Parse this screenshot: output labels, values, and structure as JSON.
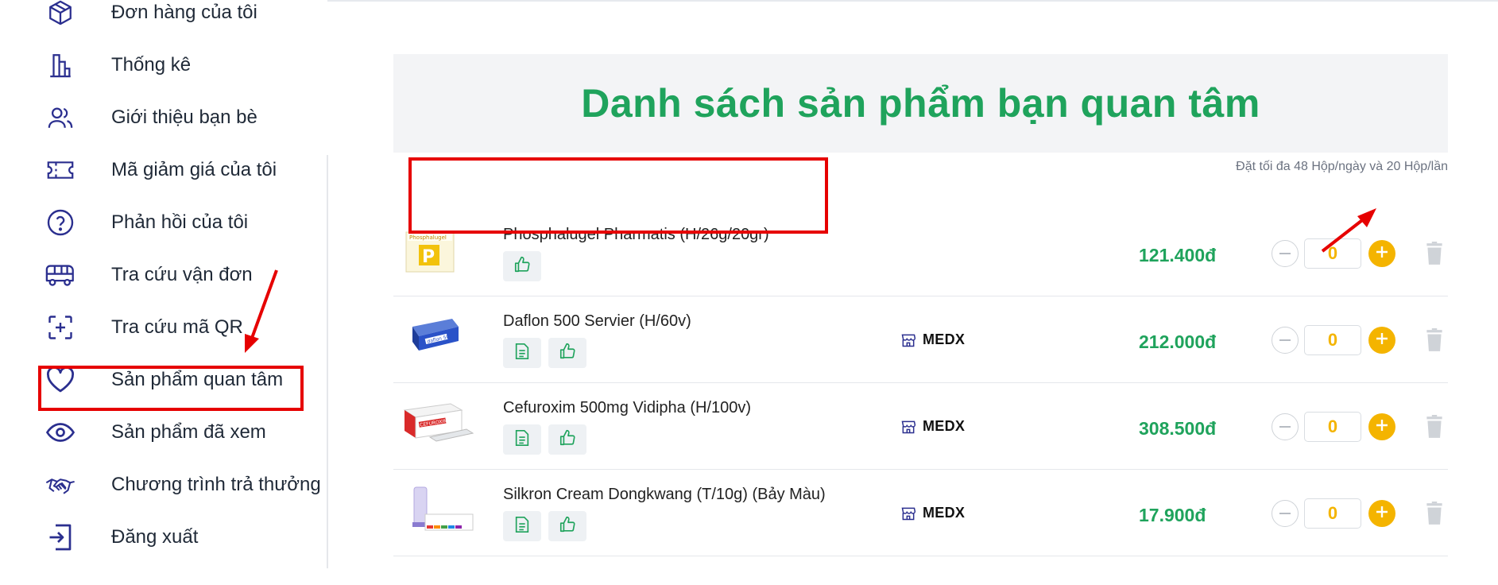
{
  "sidebar": {
    "items": [
      {
        "label": "Đơn hàng của tôi",
        "icon": "box-icon"
      },
      {
        "label": "Thống kê",
        "icon": "bar-chart-icon"
      },
      {
        "label": "Giới thiệu bạn bè",
        "icon": "users-icon"
      },
      {
        "label": "Mã giảm giá của tôi",
        "icon": "ticket-icon"
      },
      {
        "label": "Phản hồi của tôi",
        "icon": "question-circle-icon"
      },
      {
        "label": "Tra cứu vận đơn",
        "icon": "bus-icon"
      },
      {
        "label": "Tra cứu mã QR",
        "icon": "qr-scan-icon"
      },
      {
        "label": "Sản phẩm quan tâm",
        "icon": "heart-icon",
        "highlighted": true
      },
      {
        "label": "Sản phẩm đã xem",
        "icon": "eye-icon"
      },
      {
        "label": "Chương trình trả thưởng",
        "icon": "handshake-icon"
      },
      {
        "label": "Đăng xuất",
        "icon": "logout-icon"
      }
    ]
  },
  "main": {
    "title": "Danh sách sản phẩm bạn quan tâm",
    "limit_note": "Đặt tối đa 48 Hộp/ngày và 20 Hộp/lần",
    "products": [
      {
        "name": "Phosphalugel Pharmatis (H/26g/20gr)",
        "vendor": "",
        "price": "121.400đ",
        "qty": "0",
        "has_doc": false,
        "highlighted": true
      },
      {
        "name": "Daflon 500 Servier (H/60v)",
        "vendor": "MEDX",
        "price": "212.000đ",
        "qty": "0",
        "has_doc": true
      },
      {
        "name": "Cefuroxim 500mg Vidipha (H/100v)",
        "vendor": "MEDX",
        "price": "308.500đ",
        "qty": "0",
        "has_doc": true
      },
      {
        "name": "Silkron Cream Dongkwang (T/10g) (Bảy Màu)",
        "vendor": "MEDX",
        "price": "17.900đ",
        "qty": "0",
        "has_doc": true
      }
    ]
  },
  "colors": {
    "accent_green": "#1fa35c",
    "plus_yellow": "#f4b400",
    "nav_icon": "#2b2f8f",
    "annotation_red": "#e60000"
  }
}
